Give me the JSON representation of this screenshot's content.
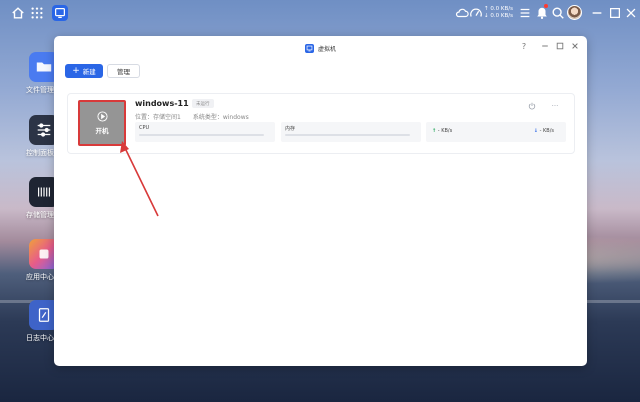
{
  "topbar": {
    "speed_up": "↑ 0.0 KB/s",
    "speed_down": "↓ 0.0 KB/s"
  },
  "desktop": {
    "items": [
      {
        "label": "文件管理",
        "icon": "folder-icon",
        "color": "#4a7bf0"
      },
      {
        "label": "控制面板",
        "icon": "sliders-icon",
        "color": "#2c3446"
      },
      {
        "label": "存储管理",
        "icon": "storage-icon",
        "color": "#1f2533"
      },
      {
        "label": "应用中心",
        "icon": "app-center-icon",
        "color": "#f26b6b"
      },
      {
        "label": "日志中心",
        "icon": "log-icon",
        "color": "#3e63c8"
      }
    ]
  },
  "window": {
    "title": "虚拟机",
    "new_button": "新建",
    "manage_button": "管理",
    "vm": {
      "name": "windows-11",
      "status_badge": "未运行",
      "location_label": "位置：",
      "location_value": "存储空间1",
      "os_label": "系统类型：",
      "os_value": "windows",
      "power_label": "开机",
      "cpu_label": "CPU",
      "mem_label": "内存",
      "net_up": "- KB/s",
      "net_down": "- KB/s",
      "cpu_usage": 0,
      "mem_usage": 0
    }
  },
  "colors": {
    "accent": "#2a66e6",
    "highlight": "#d83a3a"
  }
}
